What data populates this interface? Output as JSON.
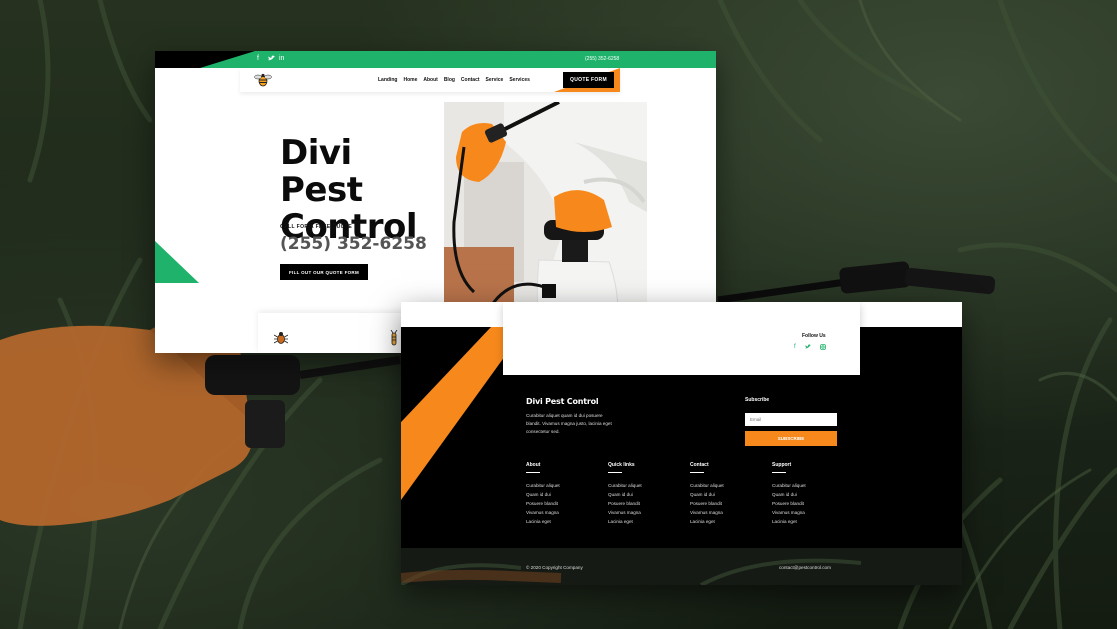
{
  "hero": {
    "top_phone": "(255) 352-6258",
    "social_icons": [
      "facebook-icon",
      "twitter-icon",
      "linkedin-icon"
    ],
    "nav_links": [
      "Landing",
      "Home",
      "About",
      "Blog",
      "Contact",
      "Service",
      "Services"
    ],
    "quote_button": "QUOTE FORM",
    "title": "Divi Pest Control",
    "call_text": "CALL FOR A FREE QUOTE",
    "phone": "(255) 352-6258",
    "cta_button": "FILL OUT OUR QUOTE FORM",
    "service_icons": [
      "spider-icon",
      "termite-icon",
      "mosquito-icon"
    ]
  },
  "footer": {
    "follow_title": "Follow Us",
    "follow_icons": [
      "facebook-icon",
      "twitter-icon",
      "instagram-icon"
    ],
    "brand": "Divi Pest Control",
    "description": "Curabitur aliquet quam id dui posuere blandit. Vivamus magna justo, lacinia eget consectetur sed.",
    "subscribe_title": "Subscribe",
    "email_placeholder": "Email",
    "subscribe_button": "SUBSCRIBE",
    "columns": [
      {
        "title": "About",
        "links": [
          "Curabitur aliquet",
          "Quam id dui",
          "Posuere blandit",
          "Vivamus magna",
          "Lacinia eget"
        ]
      },
      {
        "title": "Quick links",
        "links": [
          "Curabitur aliquet",
          "Quam id dui",
          "Posuere blandit",
          "Vivamus magna",
          "Lacinia eget"
        ]
      },
      {
        "title": "Contact",
        "links": [
          "Curabitur aliquet",
          "Quam id dui",
          "Posuere blandit",
          "Vivamus magna",
          "Lacinia eget"
        ]
      },
      {
        "title": "Support",
        "links": [
          "Curabitur aliquet",
          "Quam id dui",
          "Posuere blandit",
          "Vivamus magna",
          "Lacinia eget"
        ]
      }
    ],
    "copyright": "© 2020 Copyright Company",
    "contact_email": "contact@pestcontrol.com"
  },
  "colors": {
    "green": "#1fb26a",
    "orange": "#f7891c",
    "black": "#000000"
  }
}
